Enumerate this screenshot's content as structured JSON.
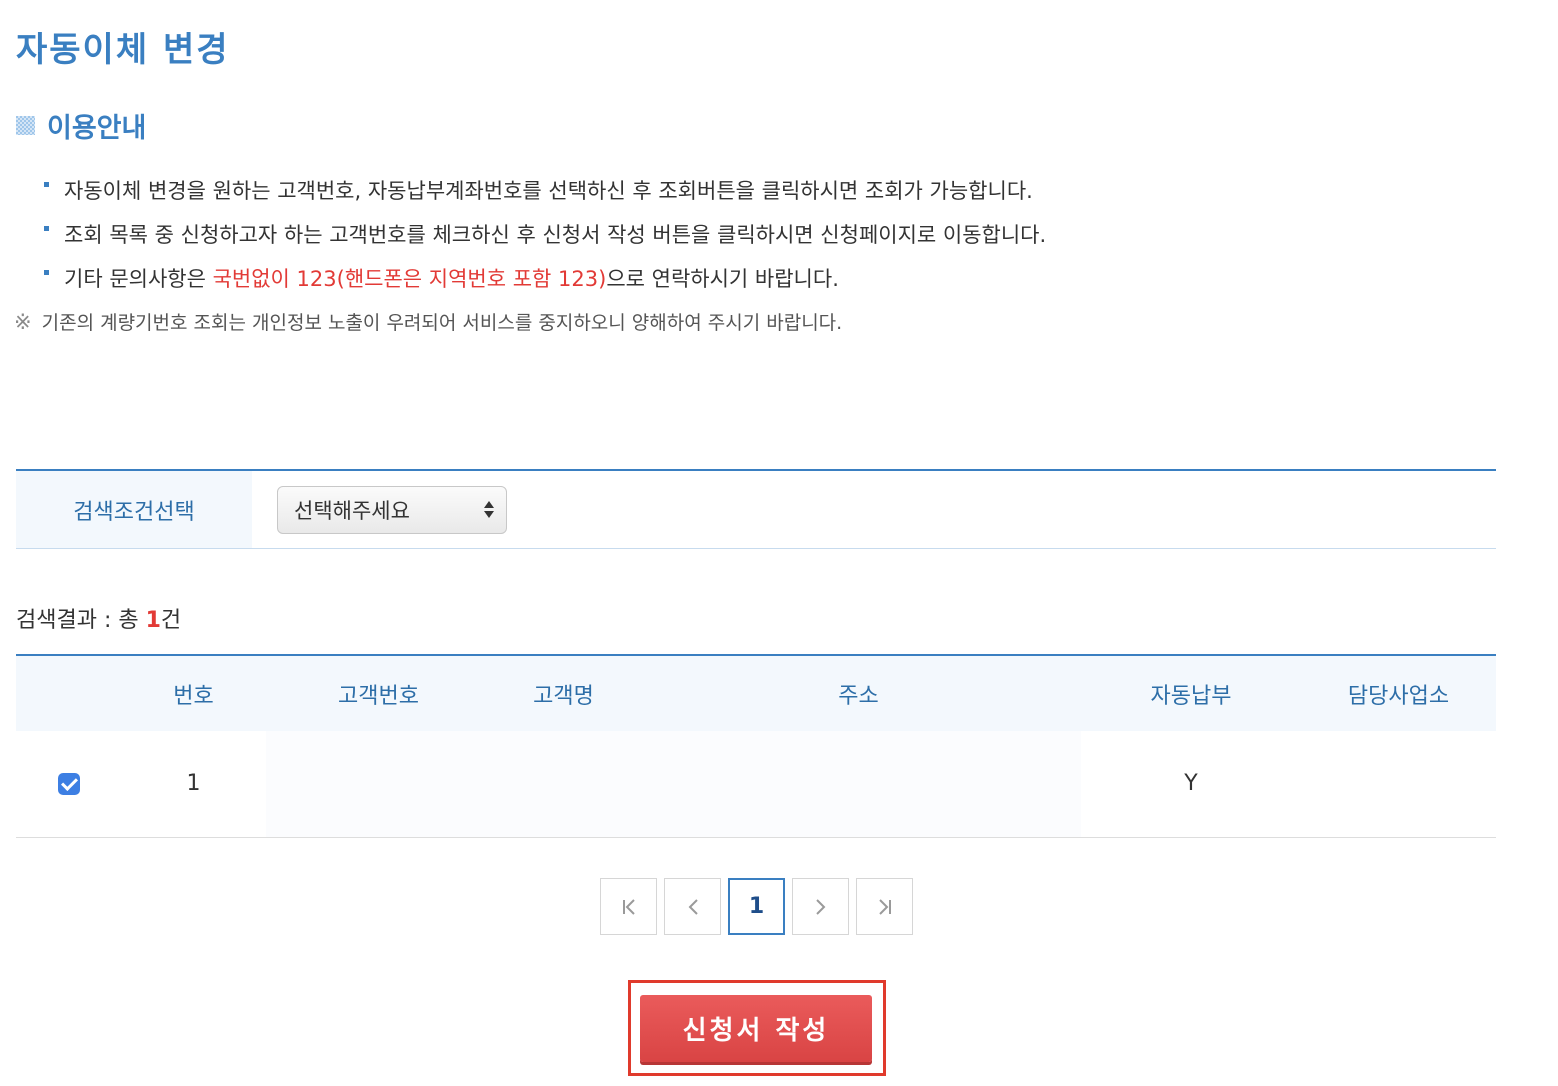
{
  "page": {
    "title": "자동이체 변경"
  },
  "guide": {
    "section_title": "이용안내",
    "item1": "자동이체 변경을 원하는 고객번호, 자동납부계좌번호를 선택하신 후 조회버튼을 클릭하시면 조회가 가능합니다.",
    "item2": "조회 목록 중 신청하고자 하는 고객번호를 체크하신 후 신청서 작성 버튼을 클릭하시면 신청페이지로 이동합니다.",
    "item3_prefix": "기타 문의사항은 ",
    "item3_highlight": "국번없이 123(핸드폰은 지역번호 포함 123)",
    "item3_suffix": "으로 연락하시기 바랍니다.",
    "notice_mark": "※",
    "notice": "기존의 계량기번호 조회는 개인정보 노출이 우려되어 서비스를 중지하오니 양해하여 주시기 바랍니다."
  },
  "search": {
    "label": "검색조건선택",
    "select_value": "선택해주세요"
  },
  "result": {
    "prefix": "검색결과 : 총 ",
    "count": "1",
    "suffix": "건"
  },
  "table": {
    "headers": [
      "",
      "번호",
      "고객번호",
      "고객명",
      "주소",
      "자동납부",
      "담당사업소"
    ],
    "rows": [
      {
        "checked": true,
        "no": "1",
        "customer_no": "",
        "customer_name": "",
        "address": "",
        "auto_pay": "Y",
        "office": ""
      }
    ]
  },
  "pagination": {
    "first": "|<",
    "prev": "<",
    "current": "1",
    "next": ">",
    "last": ">|"
  },
  "actions": {
    "apply_label": "신청서 작성"
  },
  "colors": {
    "accent_blue": "#3a7fc1",
    "highlight_red": "#e23a36",
    "apply_button": "#e05050",
    "frame_red": "#e03a2c"
  }
}
